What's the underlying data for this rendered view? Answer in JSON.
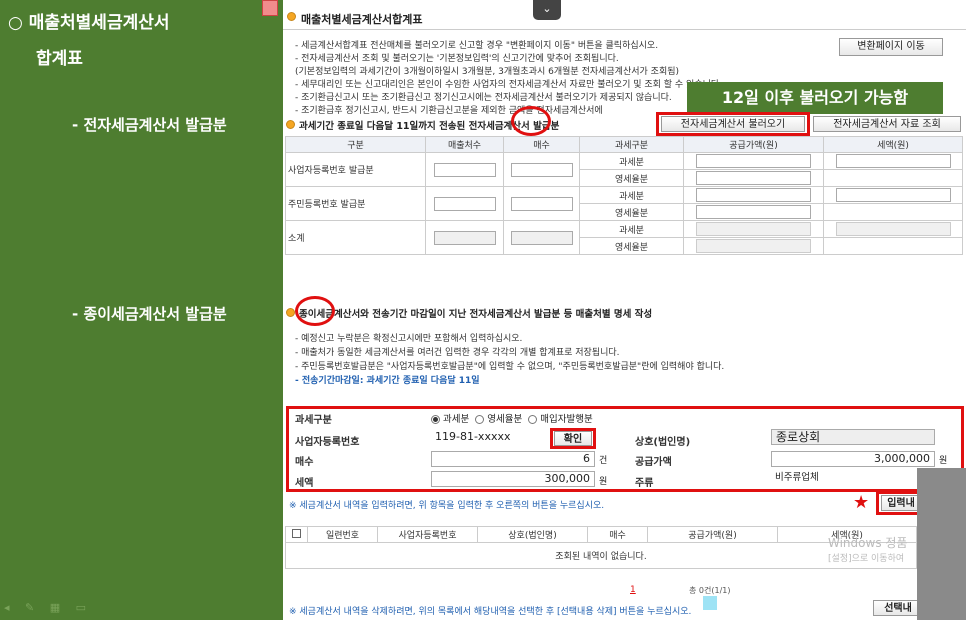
{
  "slide": {
    "title_line1": "○ 매출처별세금계산서",
    "title_line2": "합계표",
    "section_electronic": "- 전자세금계산서 발급분",
    "section_paper": "- 종이세금계산서 발급분"
  },
  "header": {
    "title": "매출처별세금계산서합계표",
    "chevron": "⌄"
  },
  "notices_top": [
    "- 세금계산서합계표 전산매체를 불러오기로 신고할 경우 \"변환페이지 이동\" 버튼을 클릭하십시오.",
    "- 전자세금계산서 조회 및 불러오기는 '기본정보입력'의 신고기간에 맞추어 조회됩니다.",
    "(기본정보입력의 과세기간이 3개월이하일시 3개월분, 3개월초과시 6개월분 전자세금계산서가 조회됨)",
    "- 세무대리인 또는 신고대리인은 본인이 수임한 사업자의 전자세금계산서 자료만 불러오기 및 조회 할 수 있습니다.",
    "- 조기환급신고시 또는 조기환급신고 정기신고시에는 전자세금계산서 불러오기가 제공되지 않습니다.",
    "- 조기환급후 정기신고시, 반드시 기환급신고분을 제외한 금액을 전자세금계산서에"
  ],
  "convert_button": "변환페이지 이동",
  "tip": "12일 이후 불러오기 가능함",
  "section1_title": "과세기간 종료일 다음달 11일까지 전송된 전자세금계산서 발급분",
  "btn_load": "전자세금계산서 불러오기",
  "btn_lookup": "전자세금계산서 자료 조회",
  "table1": {
    "headers": [
      "구분",
      "매출처수",
      "매수",
      "과세구분",
      "공급가액(원)",
      "세액(원)"
    ],
    "row1_label": "사업자등록번호 발급분",
    "row2_label": "주민등록번호 발급분",
    "row3_label": "소계",
    "taxable": "과세분",
    "zero": "영세율분"
  },
  "section2_title": "종이세금계산서와 전송기간 마감일이 지난 전자세금계산서 발급분 등 매출처별 명세 작성",
  "notices_mid": [
    "- 예정신고 누락분은 확정신고시에만 포함해서 입력하십시오.",
    "- 매출처가 동일한 세금계산서를 여러건 입력한 경우 각각의 개별 합계표로 저장됩니다.",
    "- 주민등록번호발급분은 \"사업자등록번호발급분\"에 입력할 수 없으며, \"주민등록번호발급분\"란에 입력해야 합니다."
  ],
  "deadline_note": "- 전송기간마감일: 과세기간 종료일 다음달 11일",
  "form": {
    "tax_type_label": "과세구분",
    "radio_taxable": "과세분",
    "radio_zero": "영세율분",
    "radio_buyer": "매입자발행분",
    "biz_no_label": "사업자등록번호",
    "biz_no_value": "119-81-xxxxx",
    "confirm_btn": "확인",
    "company_label": "상호(법인명)",
    "company_value": "종로상회",
    "count_label": "매수",
    "count_value": "6",
    "count_unit": "건",
    "supply_label": "공급가액",
    "supply_value": "3,000,000",
    "supply_unit": "원",
    "tax_label": "세액",
    "tax_value": "300,000",
    "tax_unit": "원",
    "kind_label": "주류",
    "kind_value": "비주류업체"
  },
  "input_note": "※ 세금계산서 내역을 입력하려면, 위 항목을 입력한 후 오른쪽의 버튼을 누르십시오.",
  "input_btn": "입력내",
  "list": {
    "headers": [
      "일련번호",
      "사업자등록번호",
      "상호(법인명)",
      "매수",
      "공급가액(원)",
      "세액(원)"
    ],
    "empty": "조회된 내역이 없습니다.",
    "page": "1",
    "total": "총 0건(1/1)"
  },
  "delete_note": "※ 세금계산서 내역을 삭제하려면, 위의 목록에서 해당내역을 선택한 후 [선택내용 삭제] 버튼을 누르십시오.",
  "select_btn": "선택내",
  "watermark1": "Windows 정품",
  "watermark2": "[설정]으로 이동하여"
}
